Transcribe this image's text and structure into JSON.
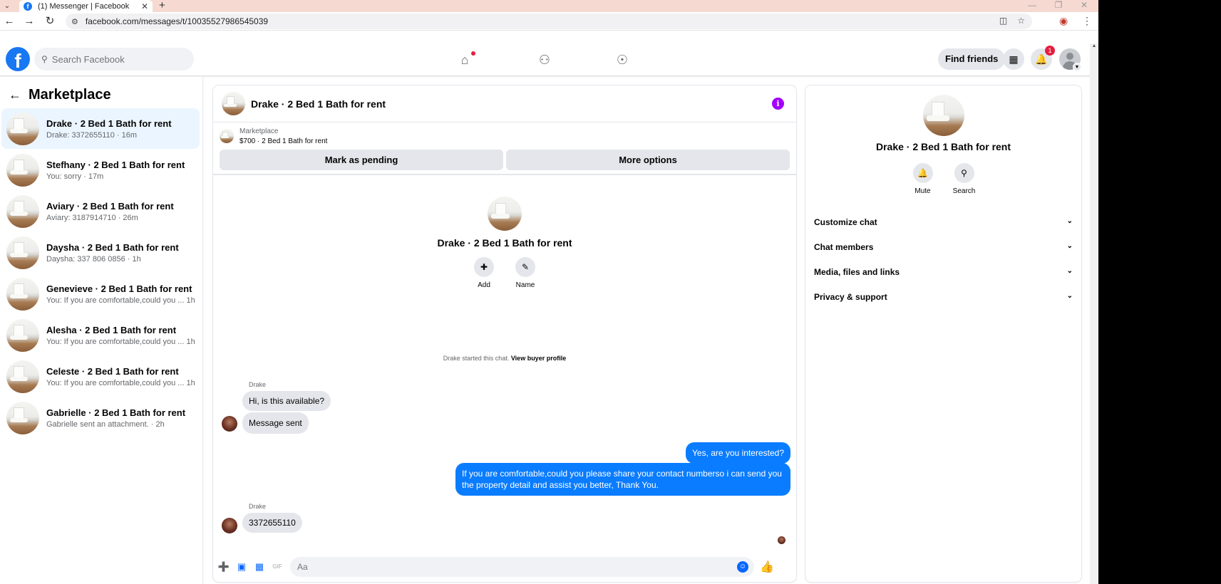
{
  "browser": {
    "tab_title": "(1) Messenger | Facebook",
    "url": "facebook.com/messages/t/10035527986545039"
  },
  "fbnav": {
    "search_placeholder": "Search Facebook",
    "find_friends": "Find friends",
    "notif_count": "1"
  },
  "sidebar": {
    "title": "Marketplace",
    "conversations": [
      {
        "name": "Drake · 2 Bed 1 Bath for rent",
        "sub": "Drake: 3372655110 · 16m"
      },
      {
        "name": "Stefhany · 2 Bed 1 Bath for rent",
        "sub": "You: sorry · 17m"
      },
      {
        "name": "Aviary · 2 Bed 1 Bath for rent",
        "sub": "Aviary: 3187914710 · 26m"
      },
      {
        "name": "Daysha · 2 Bed 1 Bath for rent",
        "sub": "Daysha: 337 806 0856 · 1h"
      },
      {
        "name": "Genevieve · 2 Bed 1 Bath for rent",
        "sub": "You: If you are comfortable,could you ...  1h"
      },
      {
        "name": "Alesha · 2 Bed 1 Bath for rent",
        "sub": "You: If you are comfortable,could you ...  1h"
      },
      {
        "name": "Celeste · 2 Bed 1 Bath for rent",
        "sub": "You: If you are comfortable,could you ...  1h"
      },
      {
        "name": "Gabrielle · 2 Bed 1 Bath for rent",
        "sub": "Gabrielle sent an attachment. · 2h"
      }
    ]
  },
  "chat": {
    "title": "Drake · 2 Bed 1 Bath for rent",
    "listing_label": "Marketplace",
    "listing_price": "$700 · 2 Bed 1 Bath for rent",
    "mark_pending": "Mark as pending",
    "more_options": "More options",
    "intro_name": "Drake · 2 Bed 1 Bath for rent",
    "add_label": "Add",
    "name_label": "Name",
    "started_text": "Drake started this chat.",
    "view_profile": "View buyer profile",
    "sender1": "Drake",
    "msg1": "Hi, is this available?",
    "msg2": "Message sent",
    "msg3": "Yes, are you interested?",
    "msg4": "If you are comfortable,could you please share your contact numberso i can send you the property detail and assist you better, Thank You.",
    "sender2": "Drake",
    "msg5": "3372655110",
    "composer_placeholder": "Aa"
  },
  "rpanel": {
    "name": "Drake · 2 Bed 1 Bath for rent",
    "mute": "Mute",
    "search": "Search",
    "sections": [
      "Customize chat",
      "Chat members",
      "Media, files and links",
      "Privacy & support"
    ]
  }
}
